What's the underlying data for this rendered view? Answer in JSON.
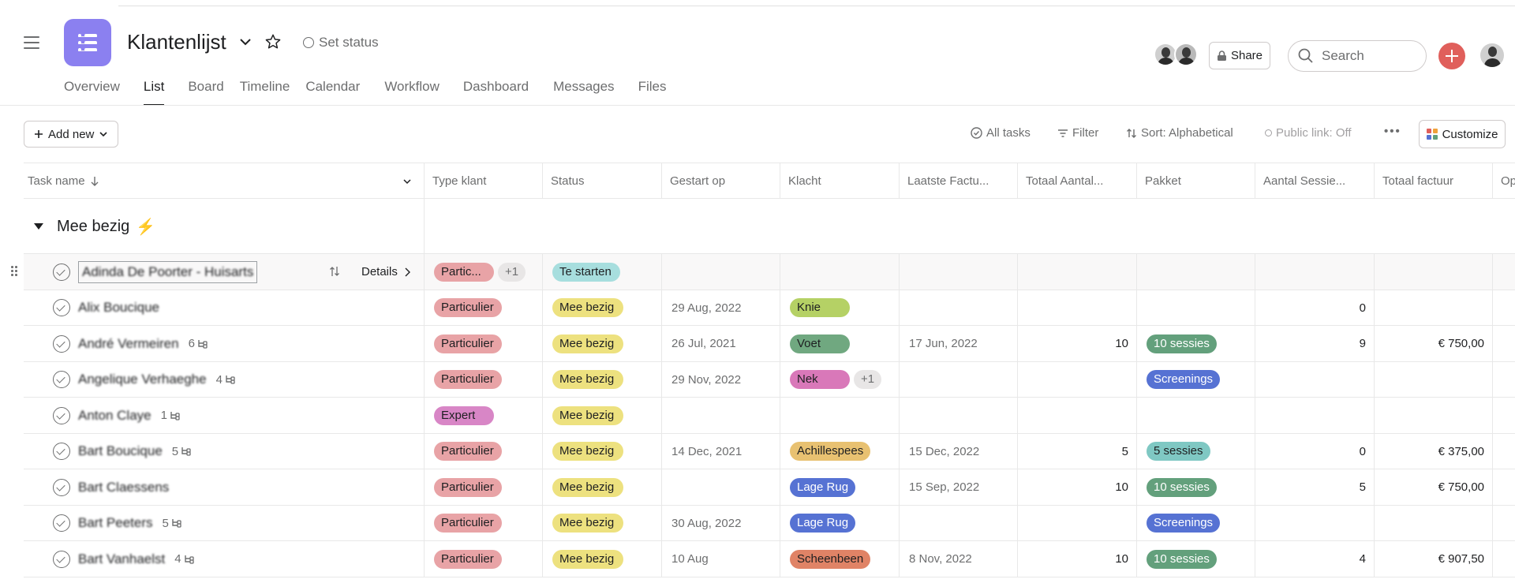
{
  "header": {
    "title": "Klantenlijst",
    "set_status": "Set status",
    "share": "Share",
    "search_placeholder": "Search",
    "colors": {
      "project_icon": "#8b80f0",
      "add_button": "#e05f5b"
    }
  },
  "tabs": [
    "Overview",
    "List",
    "Board",
    "Timeline",
    "Calendar",
    "Workflow",
    "Dashboard",
    "Messages",
    "Files"
  ],
  "active_tab": "List",
  "toolbar": {
    "add_new": "Add new",
    "all_tasks": "All tasks",
    "filter": "Filter",
    "sort": "Sort: Alphabetical",
    "public_link": "Public link: Off",
    "customize": "Customize"
  },
  "columns": [
    "Task name",
    "Type klant",
    "Status",
    "Gestart op",
    "Klacht",
    "Laatste Factu...",
    "Totaal Aantal...",
    "Pakket",
    "Aantal Sessie...",
    "Totaal factuur",
    "Op"
  ],
  "section": {
    "title": "Mee bezig",
    "emoji": "⚡"
  },
  "details_label": "Details",
  "rows": [
    {
      "name": "Adinda De Poorter - Huisarts",
      "subtasks": "",
      "type": "Partic...",
      "type_more": "+1",
      "status": "Te starten",
      "started": "",
      "klacht": "",
      "klacht_more": "",
      "last_invoice": "",
      "total_count": "",
      "pakket": "",
      "sessions": "",
      "total_invoice": ""
    },
    {
      "name": "Alix Boucique",
      "subtasks": "",
      "type": "Particulier",
      "type_more": "",
      "status": "Mee bezig",
      "started": "29 Aug, 2022",
      "klacht": "Knie",
      "klacht_more": "",
      "last_invoice": "",
      "total_count": "",
      "pakket": "",
      "sessions": "0",
      "total_invoice": ""
    },
    {
      "name": "André Vermeiren",
      "subtasks": "6",
      "type": "Particulier",
      "type_more": "",
      "status": "Mee bezig",
      "started": "26 Jul, 2021",
      "klacht": "Voet",
      "klacht_more": "",
      "last_invoice": "17 Jun, 2022",
      "total_count": "10",
      "pakket": "10 sessies",
      "sessions": "9",
      "total_invoice": "€ 750,00"
    },
    {
      "name": "Angelique Verhaeghe",
      "subtasks": "4",
      "type": "Particulier",
      "type_more": "",
      "status": "Mee bezig",
      "started": "29 Nov, 2022",
      "klacht": "Nek",
      "klacht_more": "+1",
      "last_invoice": "",
      "total_count": "",
      "pakket": "Screenings",
      "sessions": "",
      "total_invoice": ""
    },
    {
      "name": "Anton Claye",
      "subtasks": "1",
      "type": "Expert",
      "type_more": "",
      "status": "Mee bezig",
      "started": "",
      "klacht": "",
      "klacht_more": "",
      "last_invoice": "",
      "total_count": "",
      "pakket": "",
      "sessions": "",
      "total_invoice": ""
    },
    {
      "name": "Bart Boucique",
      "subtasks": "5",
      "type": "Particulier",
      "type_more": "",
      "status": "Mee bezig",
      "started": "14 Dec, 2021",
      "klacht": "Achillespees",
      "klacht_more": "",
      "last_invoice": "15 Dec, 2022",
      "total_count": "5",
      "pakket": "5 sessies",
      "sessions": "0",
      "total_invoice": "€ 375,00"
    },
    {
      "name": "Bart Claessens",
      "subtasks": "",
      "type": "Particulier",
      "type_more": "",
      "status": "Mee bezig",
      "started": "",
      "klacht": "Lage Rug",
      "klacht_more": "",
      "last_invoice": "15 Sep, 2022",
      "total_count": "10",
      "pakket": "10 sessies",
      "sessions": "5",
      "total_invoice": "€ 750,00"
    },
    {
      "name": "Bart Peeters",
      "subtasks": "5",
      "type": "Particulier",
      "type_more": "",
      "status": "Mee bezig",
      "started": "30 Aug, 2022",
      "klacht": "Lage Rug",
      "klacht_more": "",
      "last_invoice": "",
      "total_count": "",
      "pakket": "Screenings",
      "sessions": "",
      "total_invoice": ""
    },
    {
      "name": "Bart Vanhaelst",
      "subtasks": "4",
      "type": "Particulier",
      "type_more": "",
      "status": "Mee bezig",
      "started": "10 Aug",
      "klacht": "Scheenbeen",
      "klacht_more": "",
      "last_invoice": "8 Nov, 2022",
      "total_count": "10",
      "pakket": "10 sessies",
      "sessions": "4",
      "total_invoice": "€ 907,50"
    }
  ],
  "tag_colors": {
    "Particulier": "#e8a3a6",
    "Partic...": "#e8a3a6",
    "Expert": "#d886c6",
    "Te starten": "#a7dede",
    "Mee bezig": "#ede17f",
    "Knie": "#b5d165",
    "Voet": "#70a880",
    "Nek": "#d978b9",
    "Achillespees": "#e8c171",
    "Lage Rug": "#5672d3",
    "Scheenbeen": "#e08366",
    "10 sessies": "#63a07c",
    "5 sessies": "#7fc8c3",
    "Screenings": "#5672d3"
  },
  "white_text_tags": [
    "Lage Rug",
    "Screenings",
    "10 sessies"
  ]
}
